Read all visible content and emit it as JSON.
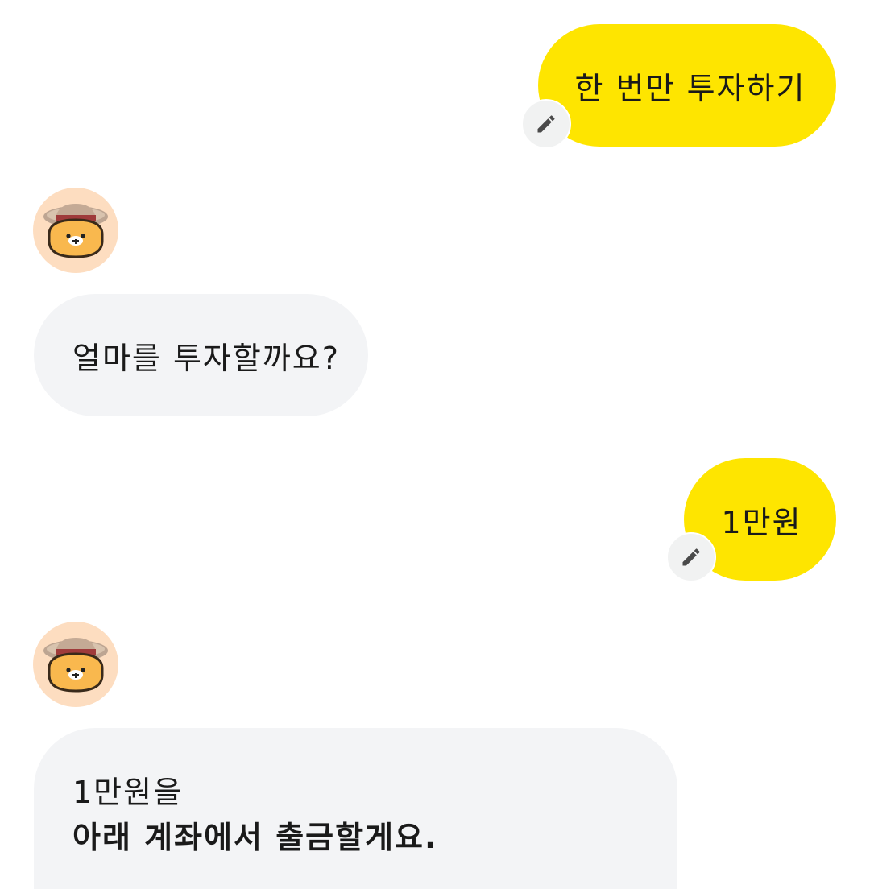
{
  "messages": [
    {
      "role": "user",
      "text": "한 번만 투자하기"
    },
    {
      "role": "bot",
      "text": "얼마를 투자할까요?"
    },
    {
      "role": "user",
      "text": "1만원"
    },
    {
      "role": "bot",
      "line1": "1만원을",
      "line2": "아래 계좌에서 출금할게요."
    }
  ],
  "icons": {
    "edit": "pencil-icon",
    "avatar": "bot-character-avatar"
  },
  "colors": {
    "user_bubble": "#FEE500",
    "bot_bubble": "#F3F4F6",
    "avatar_bg": "#FDDDC0",
    "edit_button_bg": "#F1F2F2"
  }
}
